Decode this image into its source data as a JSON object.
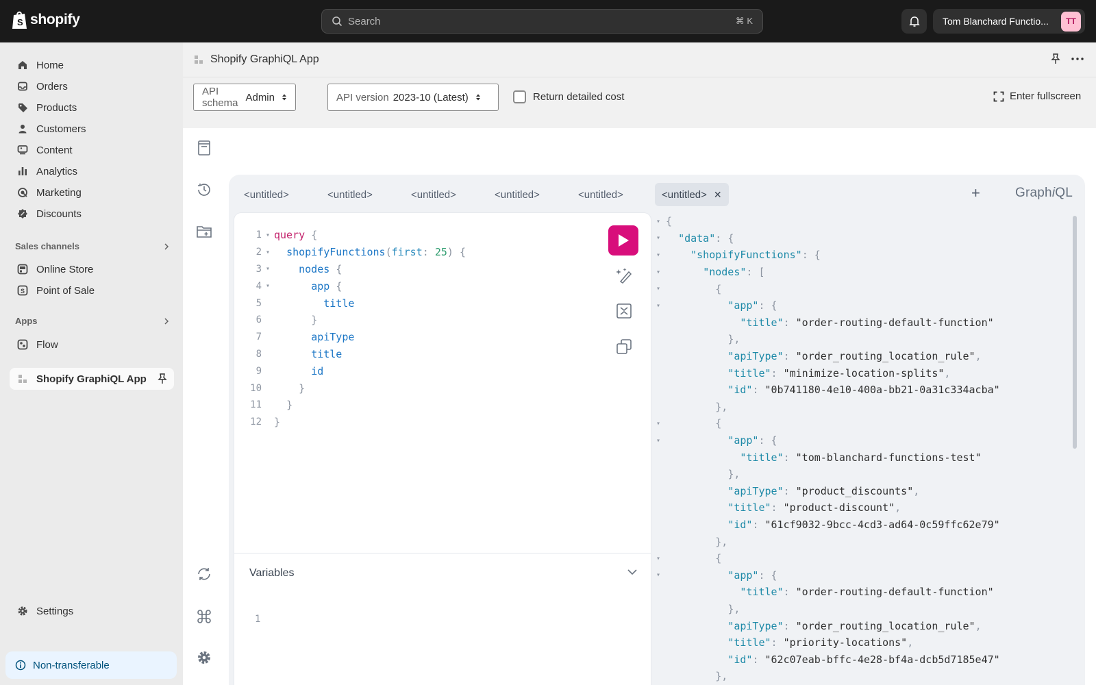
{
  "topbar": {
    "brand": "shopify",
    "search_placeholder": "Search",
    "search_shortcut": "⌘ K",
    "account_name": "Tom Blanchard Functio...",
    "avatar_initials": "TT"
  },
  "sidebar": {
    "items": [
      {
        "label": "Home",
        "icon": "home-icon"
      },
      {
        "label": "Orders",
        "icon": "inbox-icon"
      },
      {
        "label": "Products",
        "icon": "tag-icon"
      },
      {
        "label": "Customers",
        "icon": "person-icon"
      },
      {
        "label": "Content",
        "icon": "content-icon"
      },
      {
        "label": "Analytics",
        "icon": "bar-chart-icon"
      },
      {
        "label": "Marketing",
        "icon": "target-icon"
      },
      {
        "label": "Discounts",
        "icon": "discount-icon"
      }
    ],
    "sales_channels_title": "Sales channels",
    "sales_channels": [
      {
        "label": "Online Store",
        "icon": "store-icon"
      },
      {
        "label": "Point of Sale",
        "icon": "pos-icon"
      }
    ],
    "apps_title": "Apps",
    "apps": [
      {
        "label": "Flow",
        "icon": "flow-icon"
      },
      {
        "label": "Shopify GraphiQL App",
        "icon": "app-icon"
      }
    ],
    "settings_label": "Settings",
    "badge_label": "Non-transferable"
  },
  "app": {
    "title": "Shopify GraphiQL App",
    "schema_label": "API schema",
    "schema_value": "Admin",
    "version_label": "API version",
    "version_value": "2023-10 (Latest)",
    "detailed_cost_label": "Return detailed cost",
    "detailed_cost_checked": false,
    "fullscreen_label": "Enter fullscreen"
  },
  "graphiql": {
    "brand_prefix": "Graph",
    "brand_i": "i",
    "brand_suffix": "QL",
    "tabs": [
      "<untitled>",
      "<untitled>",
      "<untitled>",
      "<untitled>",
      "<untitled>",
      "<untitled>"
    ],
    "active_tab": 5,
    "variables_label": "Variables",
    "variables_line": "1",
    "query_lines": [
      {
        "n": "1",
        "fold": "▾",
        "code": "query {"
      },
      {
        "n": "2",
        "fold": "▾",
        "code": "  shopifyFunctions(first: 25) {"
      },
      {
        "n": "3",
        "fold": "▾",
        "code": "    nodes {"
      },
      {
        "n": "4",
        "fold": "▾",
        "code": "      app {"
      },
      {
        "n": "5",
        "fold": "",
        "code": "        title"
      },
      {
        "n": "6",
        "fold": "",
        "code": "      }"
      },
      {
        "n": "7",
        "fold": "",
        "code": "      apiType"
      },
      {
        "n": "8",
        "fold": "",
        "code": "      title"
      },
      {
        "n": "9",
        "fold": "",
        "code": "      id"
      },
      {
        "n": "10",
        "fold": "",
        "code": "    }"
      },
      {
        "n": "11",
        "fold": "",
        "code": "  }"
      },
      {
        "n": "12",
        "fold": "",
        "code": "}"
      }
    ],
    "result_lines": [
      {
        "fold": "▾",
        "text": "{"
      },
      {
        "fold": "▾",
        "text": "  \"data\": {"
      },
      {
        "fold": "▾",
        "text": "    \"shopifyFunctions\": {"
      },
      {
        "fold": "▾",
        "text": "      \"nodes\": ["
      },
      {
        "fold": "▾",
        "text": "        {"
      },
      {
        "fold": "▾",
        "text": "          \"app\": {"
      },
      {
        "fold": "",
        "text": "            \"title\": \"order-routing-default-function\""
      },
      {
        "fold": "",
        "text": "          },"
      },
      {
        "fold": "",
        "text": "          \"apiType\": \"order_routing_location_rule\","
      },
      {
        "fold": "",
        "text": "          \"title\": \"minimize-location-splits\","
      },
      {
        "fold": "",
        "text": "          \"id\": \"0b741180-4e10-400a-bb21-0a31c334acba\""
      },
      {
        "fold": "",
        "text": "        },"
      },
      {
        "fold": "▾",
        "text": "        {"
      },
      {
        "fold": "▾",
        "text": "          \"app\": {"
      },
      {
        "fold": "",
        "text": "            \"title\": \"tom-blanchard-functions-test\""
      },
      {
        "fold": "",
        "text": "          },"
      },
      {
        "fold": "",
        "text": "          \"apiType\": \"product_discounts\","
      },
      {
        "fold": "",
        "text": "          \"title\": \"product-discount\","
      },
      {
        "fold": "",
        "text": "          \"id\": \"61cf9032-9bcc-4cd3-ad64-0c59ffc62e79\"",
        "highlight": true
      },
      {
        "fold": "",
        "text": "        },"
      },
      {
        "fold": "▾",
        "text": "        {"
      },
      {
        "fold": "▾",
        "text": "          \"app\": {"
      },
      {
        "fold": "",
        "text": "            \"title\": \"order-routing-default-function\""
      },
      {
        "fold": "",
        "text": "          },"
      },
      {
        "fold": "",
        "text": "          \"apiType\": \"order_routing_location_rule\","
      },
      {
        "fold": "",
        "text": "          \"title\": \"priority-locations\","
      },
      {
        "fold": "",
        "text": "          \"id\": \"62c07eab-bffc-4e28-bf4a-dcb5d7185e47\""
      },
      {
        "fold": "",
        "text": "        },"
      },
      {
        "fold": "▾",
        "text": "        {"
      }
    ]
  },
  "colors": {
    "topbar": "#1a1a1a",
    "run_button": "#d80e7b",
    "json_key": "#1e8aa8",
    "json_string": "#d9750b",
    "keyword": "#c3216b"
  }
}
